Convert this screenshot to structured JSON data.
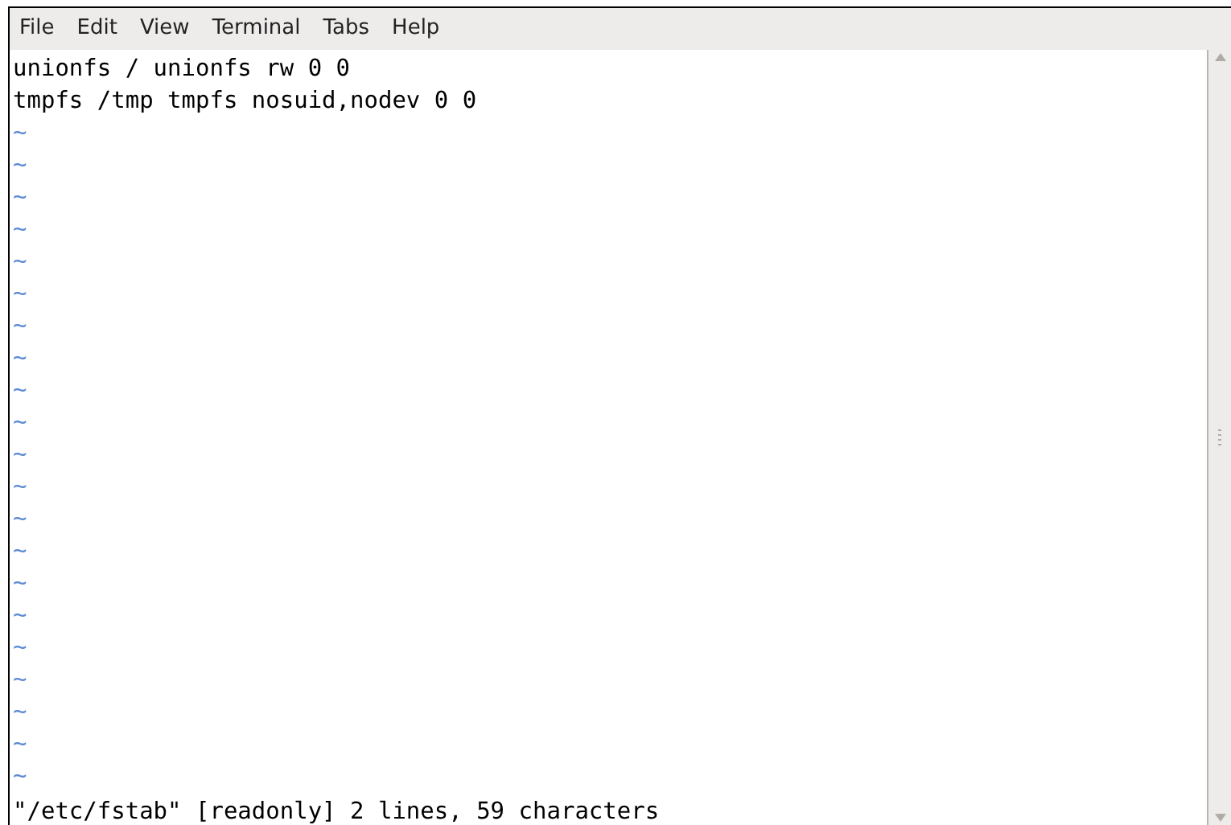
{
  "menu_bar": [
    "File",
    "Edit",
    "View",
    "Terminal",
    "Tabs",
    "Help"
  ],
  "buffer_lines": [
    {
      "kind": "text",
      "text": "unionfs / unionfs rw 0 0"
    },
    {
      "kind": "text",
      "text": "tmpfs /tmp tmpfs nosuid,nodev 0 0"
    },
    {
      "kind": "empty",
      "text": "~"
    },
    {
      "kind": "empty",
      "text": "~"
    },
    {
      "kind": "empty",
      "text": "~"
    },
    {
      "kind": "empty",
      "text": "~"
    },
    {
      "kind": "empty",
      "text": "~"
    },
    {
      "kind": "empty",
      "text": "~"
    },
    {
      "kind": "empty",
      "text": "~"
    },
    {
      "kind": "empty",
      "text": "~"
    },
    {
      "kind": "empty",
      "text": "~"
    },
    {
      "kind": "empty",
      "text": "~"
    },
    {
      "kind": "empty",
      "text": "~"
    },
    {
      "kind": "empty",
      "text": "~"
    },
    {
      "kind": "empty",
      "text": "~"
    },
    {
      "kind": "empty",
      "text": "~"
    },
    {
      "kind": "empty",
      "text": "~"
    },
    {
      "kind": "empty",
      "text": "~"
    },
    {
      "kind": "empty",
      "text": "~"
    },
    {
      "kind": "empty",
      "text": "~"
    },
    {
      "kind": "empty",
      "text": "~"
    },
    {
      "kind": "empty",
      "text": "~"
    },
    {
      "kind": "empty",
      "text": "~"
    }
  ],
  "status_line": "\"/etc/fstab\" [readonly] 2 lines, 59 characters"
}
